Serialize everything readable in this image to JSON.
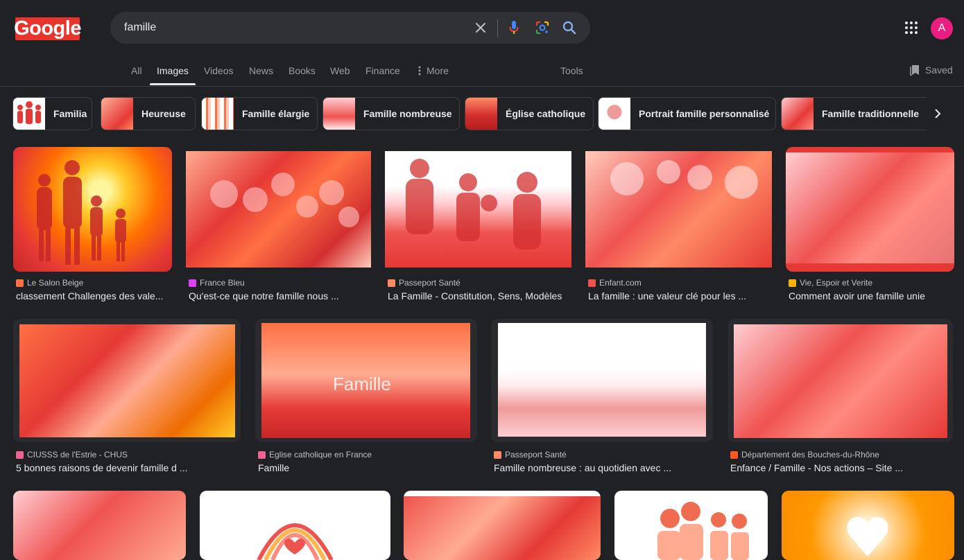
{
  "logo": {
    "text": "Google"
  },
  "search": {
    "query": "famille"
  },
  "avatar": {
    "letter": "A"
  },
  "tabs": [
    {
      "label": "All"
    },
    {
      "label": "Images"
    },
    {
      "label": "Videos"
    },
    {
      "label": "News"
    },
    {
      "label": "Books"
    },
    {
      "label": "Web"
    },
    {
      "label": "Finance"
    },
    {
      "label": "More"
    },
    {
      "label": "Tools"
    }
  ],
  "saved_label": "Saved",
  "chips": [
    {
      "label": "Familia"
    },
    {
      "label": "Heureuse"
    },
    {
      "label": "Famille élargie"
    },
    {
      "label": "Famille nombreuse"
    },
    {
      "label": "Église catholique"
    },
    {
      "label": "Portrait famille personnalisé"
    },
    {
      "label": "Famille traditionnelle"
    }
  ],
  "results": [
    {
      "source": "Le Salon Beige",
      "title": "classement Challenges des vale..."
    },
    {
      "source": "France Bleu",
      "title": "Qu'est-ce que notre famille nous ..."
    },
    {
      "source": "Passeport Santé",
      "title": "La Famille - Constitution, Sens, Modèles"
    },
    {
      "source": "Enfant.com",
      "title": "La famille : une valeur clé pour les ..."
    },
    {
      "source": "Vie, Espoir et Verite",
      "title": "Comment avoir une famille unie"
    },
    {
      "source": "CIUSSS de l'Estrie - CHUS",
      "title": "5 bonnes raisons de devenir famille d ..."
    },
    {
      "source": "Eglise catholique en France",
      "title": "Famille",
      "overlay": "Famille"
    },
    {
      "source": "Passeport Santé",
      "title": "Famille nombreuse : au quotidien avec ..."
    },
    {
      "source": "Département des Bouches-du-Rhône",
      "title": "Enfance / Famille - Nos actions – Site ..."
    }
  ],
  "colors": {
    "background": "#202124",
    "text": "#e8eaed",
    "muted": "#9aa0a6",
    "logo_bg": "#e8352b",
    "avatar_bg": "#e91e80"
  }
}
